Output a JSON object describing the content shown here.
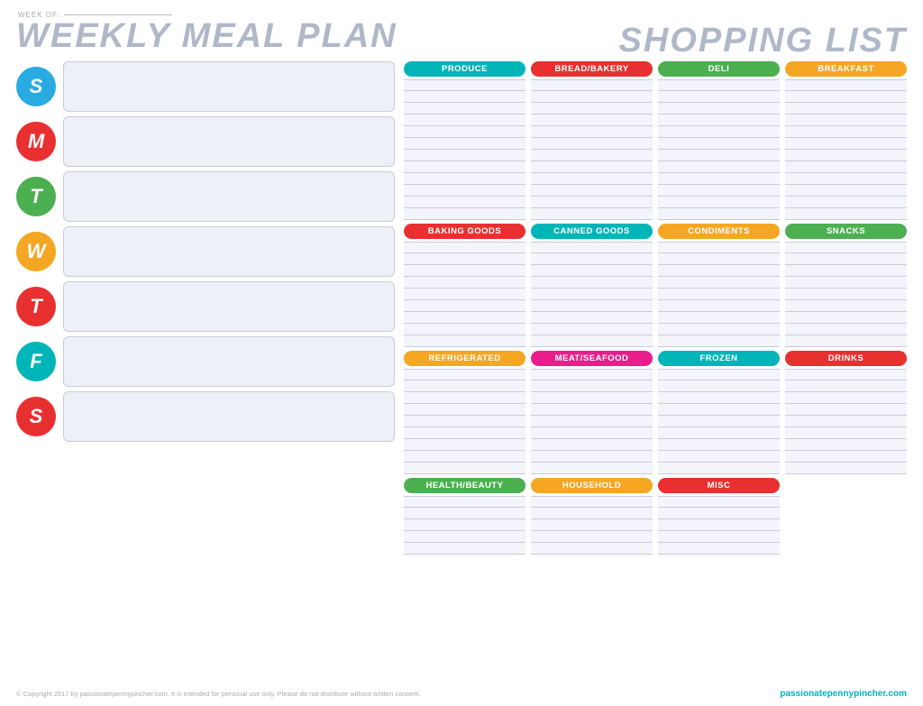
{
  "weekOf": {
    "label": "WEEK OF:"
  },
  "mealPlan": {
    "title": "WEEKLY MEAL PLAN",
    "days": [
      {
        "letter": "S",
        "color": "#29abe2"
      },
      {
        "letter": "M",
        "color": "#e83030"
      },
      {
        "letter": "T",
        "color": "#4caf50"
      },
      {
        "letter": "W",
        "color": "#f5a623"
      },
      {
        "letter": "T",
        "color": "#e83030"
      },
      {
        "letter": "F",
        "color": "#00b5b8"
      },
      {
        "letter": "S",
        "color": "#e83030"
      }
    ]
  },
  "shoppingList": {
    "title": "SHOPPING LIST",
    "sections": [
      {
        "cols": [
          {
            "label": "PRODUCE",
            "color": "#00b5b8",
            "lines": 12
          },
          {
            "label": "BREAD/BAKERY",
            "color": "#e83030",
            "lines": 12
          },
          {
            "label": "DELI",
            "color": "#4caf50",
            "lines": 12
          },
          {
            "label": "BREAKFAST",
            "color": "#f5a623",
            "lines": 12
          }
        ]
      },
      {
        "cols": [
          {
            "label": "BAKING GOODS",
            "color": "#e83030",
            "lines": 9
          },
          {
            "label": "CANNED GOODS",
            "color": "#00b5b8",
            "lines": 9
          },
          {
            "label": "CONDIMENTS",
            "color": "#f5a623",
            "lines": 9
          },
          {
            "label": "SNACKS",
            "color": "#4caf50",
            "lines": 9
          }
        ]
      },
      {
        "cols": [
          {
            "label": "REFRIGERATED",
            "color": "#f5a623",
            "lines": 9
          },
          {
            "label": "MEAT/SEAFOOD",
            "color": "#e91e8c",
            "lines": 9
          },
          {
            "label": "FROZEN",
            "color": "#00b5b8",
            "lines": 9
          },
          {
            "label": "DRINKS",
            "color": "#e83030",
            "lines": 9
          }
        ]
      },
      {
        "cols": [
          {
            "label": "HEALTH/BEAUTY",
            "color": "#4caf50",
            "lines": 5
          },
          {
            "label": "HOUSEHOLD",
            "color": "#f5a623",
            "lines": 5
          },
          {
            "label": "MISC",
            "color": "#e83030",
            "lines": 5
          },
          {
            "label": "",
            "color": "transparent",
            "lines": 0
          }
        ]
      }
    ]
  },
  "footer": {
    "copyright": "© Copyright 2017 by passionatepennypincher.com. It is intended for personal use only. Please do not distribute without written consent.",
    "brand": "passionatepennypincher.com"
  }
}
